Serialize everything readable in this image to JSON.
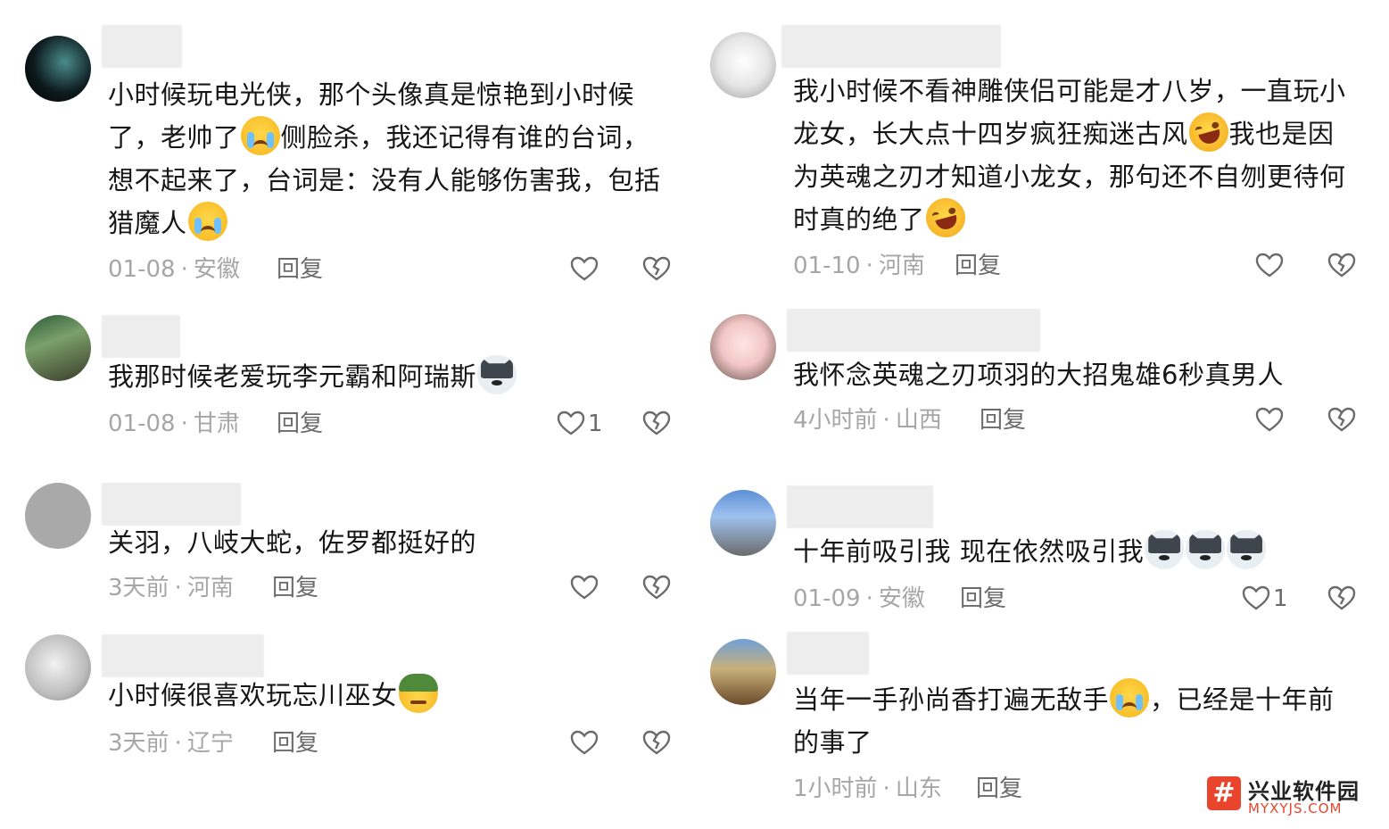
{
  "reply_label": "回复",
  "left_comments": [
    {
      "text_parts": [
        "小时候玩电光侠，那个头像真是惊艳到小时候了，老帅了",
        "cry",
        "侧脸杀，我还记得有谁的台词，想不起来了，台词是：没有人能够伤害我，包括猎魔人",
        "cry"
      ],
      "date": "01-08",
      "location": "安徽",
      "likes": ""
    },
    {
      "text_parts": [
        "我那时候老爱玩李元霸和阿瑞斯",
        "dog"
      ],
      "date": "01-08",
      "location": "甘肃",
      "likes": "1"
    },
    {
      "text_parts": [
        "关羽，八岐大蛇，佐罗都挺好的"
      ],
      "date": "3天前",
      "location": "河南",
      "likes": ""
    },
    {
      "text_parts": [
        "小时候很喜欢玩忘川巫女",
        "helmet"
      ],
      "date": "3天前",
      "location": "辽宁",
      "likes": ""
    }
  ],
  "right_comments": [
    {
      "text_parts": [
        "我小时候不看神雕侠侣可能是才八岁，一直玩小龙女，长大点十四岁疯狂痴迷古风",
        "laugh",
        "我也是因为英魂之刃才知道小龙女，那句还不自刎更待何时真的绝了",
        "laugh"
      ],
      "date": "01-10",
      "location": "河南",
      "likes": ""
    },
    {
      "text_parts": [
        "我怀念英魂之刃项羽的大招鬼雄6秒真男人"
      ],
      "date": "4小时前",
      "location": "山西",
      "likes": ""
    },
    {
      "text_parts": [
        "十年前吸引我 现在依然吸引我",
        "dog",
        "dog",
        "dog"
      ],
      "date": "01-09",
      "location": "安徽",
      "likes": "1"
    },
    {
      "text_parts": [
        "当年一手孙尚香打遍无敌手",
        "cry",
        "，已经是十年前的事了"
      ],
      "date": "1小时前",
      "location": "山东",
      "likes": ""
    }
  ],
  "emoji_names": {
    "cry": "loudly-crying-emoji",
    "laugh": "rofl-emoji",
    "dog": "husky-emoji",
    "helmet": "helmet-emoji"
  },
  "watermark": {
    "title": "兴业软件园",
    "url": "MYXYJS.COM",
    "logo": "#"
  },
  "colors": {
    "meta": "#a6a6a6",
    "reply": "#6b6b6b",
    "text": "#161616",
    "brand": "#e8452c"
  }
}
